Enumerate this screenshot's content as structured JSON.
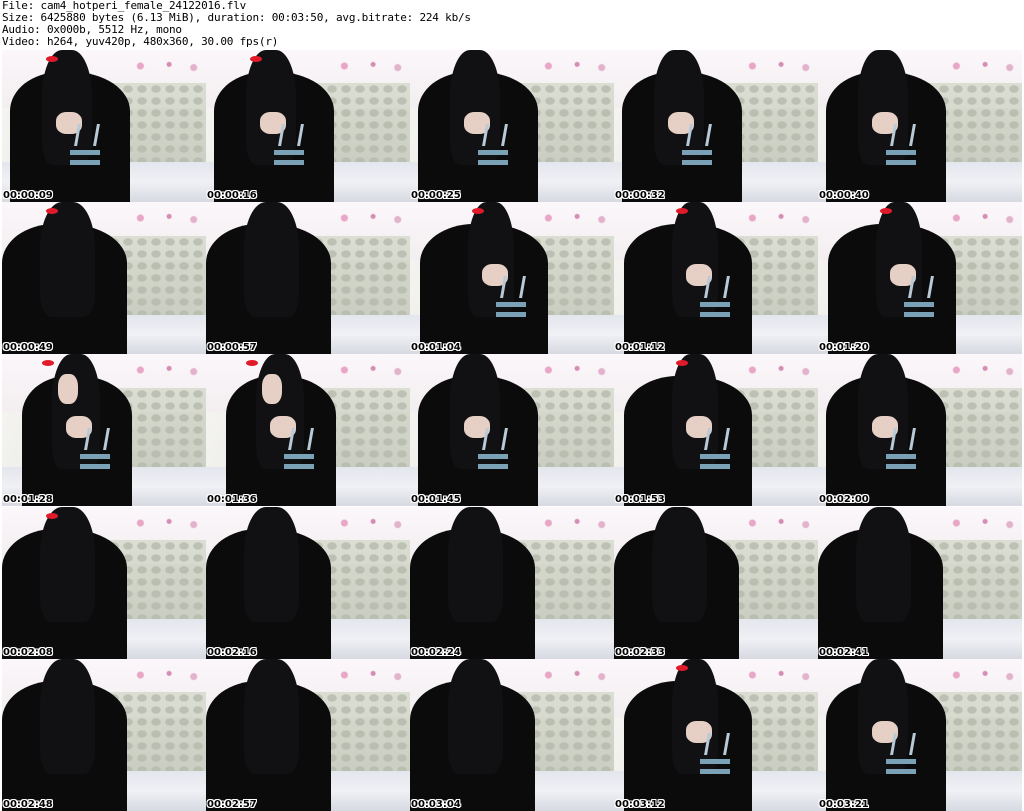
{
  "header": {
    "file": "File: cam4_hotperi_female_24122016.flv",
    "size": "Size: 6425880 bytes (6.13 MiB), duration: 00:03:50, avg.bitrate: 224 kb/s",
    "audio": "Audio: 0x000b, 5512 Hz, mono",
    "video": "Video: h264, yuv420p, 480x360, 30.00 fps(r)"
  },
  "thumbnails": [
    {
      "timestamp": "00:00:09",
      "variant": "a"
    },
    {
      "timestamp": "00:00:16",
      "variant": "a"
    },
    {
      "timestamp": "00:00:25",
      "variant": "a"
    },
    {
      "timestamp": "00:00:32",
      "variant": "a"
    },
    {
      "timestamp": "00:00:40",
      "variant": "a"
    },
    {
      "timestamp": "00:00:49",
      "variant": "b"
    },
    {
      "timestamp": "00:00:57",
      "variant": "b"
    },
    {
      "timestamp": "00:01:04",
      "variant": "c"
    },
    {
      "timestamp": "00:01:12",
      "variant": "c"
    },
    {
      "timestamp": "00:01:20",
      "variant": "c"
    },
    {
      "timestamp": "00:01:28",
      "variant": "d"
    },
    {
      "timestamp": "00:01:36",
      "variant": "d"
    },
    {
      "timestamp": "00:01:45",
      "variant": "a"
    },
    {
      "timestamp": "00:01:53",
      "variant": "c"
    },
    {
      "timestamp": "00:02:00",
      "variant": "a"
    },
    {
      "timestamp": "00:02:08",
      "variant": "b"
    },
    {
      "timestamp": "00:02:16",
      "variant": "b"
    },
    {
      "timestamp": "00:02:24",
      "variant": "b"
    },
    {
      "timestamp": "00:02:33",
      "variant": "b"
    },
    {
      "timestamp": "00:02:41",
      "variant": "b"
    },
    {
      "timestamp": "00:02:48",
      "variant": "b"
    },
    {
      "timestamp": "00:02:57",
      "variant": "b"
    },
    {
      "timestamp": "00:03:04",
      "variant": "b"
    },
    {
      "timestamp": "00:03:12",
      "variant": "c"
    },
    {
      "timestamp": "00:03:21",
      "variant": "a"
    }
  ]
}
